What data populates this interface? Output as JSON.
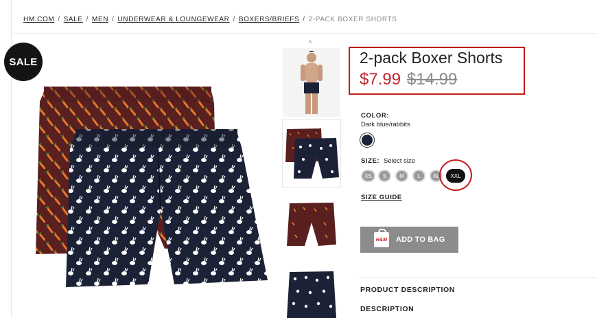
{
  "breadcrumb": {
    "items": [
      "HM.COM",
      "SALE",
      "MEN",
      "UNDERWEAR & LOUNGEWEAR",
      "BOXERS/BRIEFS"
    ],
    "current": "2-PACK BOXER SHORTS",
    "separator": "/"
  },
  "badge": {
    "label": "SALE"
  },
  "product": {
    "title": "2-pack Boxer Shorts",
    "price": "$7.99",
    "old_price": "$14.99"
  },
  "color": {
    "label": "COLOR:",
    "value": "Dark blue/rabbits",
    "swatch_hex": "#1b2238"
  },
  "size": {
    "label": "SIZE:",
    "hint": "Select size",
    "options": [
      "XS",
      "S",
      "M",
      "L",
      "XL",
      "XXL"
    ],
    "selected": "XXL"
  },
  "size_guide": "SIZE GUIDE",
  "add_to_bag": {
    "label": "ADD TO BAG",
    "icon_text": "H&M"
  },
  "sections": {
    "product_description": "PRODUCT DESCRIPTION",
    "description": "DESCRIPTION"
  },
  "colors": {
    "accent_red": "#c0272d",
    "highlight_box": "#c21b1b",
    "button_grey": "#8c8c8c"
  },
  "icons": {
    "thumb_scroll": "chevron-up-icon",
    "bag": "shopping-bag-icon"
  }
}
